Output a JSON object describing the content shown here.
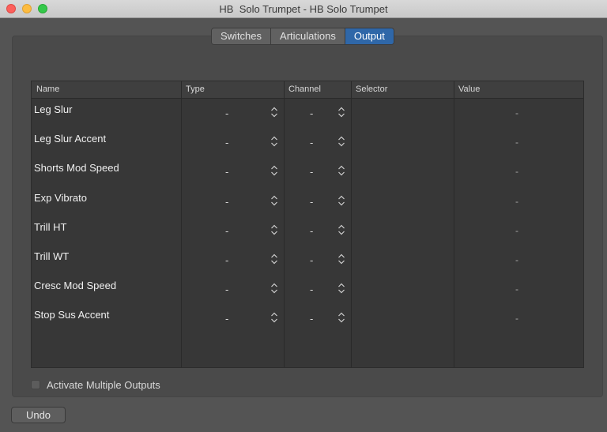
{
  "window": {
    "title": "HB  Solo Trumpet - HB Solo Trumpet"
  },
  "tabs": [
    {
      "label": "Switches",
      "active": false
    },
    {
      "label": "Articulations",
      "active": false
    },
    {
      "label": "Output",
      "active": true
    }
  ],
  "table": {
    "columns": [
      "Name",
      "Type",
      "Channel",
      "Selector",
      "Value"
    ],
    "rows": [
      {
        "name": "Leg Slur",
        "type": "-",
        "channel": "-",
        "selector": "",
        "value": "-"
      },
      {
        "name": "Leg Slur Accent",
        "type": "-",
        "channel": "-",
        "selector": "",
        "value": "-"
      },
      {
        "name": "Shorts Mod Speed",
        "type": "-",
        "channel": "-",
        "selector": "",
        "value": "-"
      },
      {
        "name": "Exp Vibrato",
        "type": "-",
        "channel": "-",
        "selector": "",
        "value": "-"
      },
      {
        "name": "Trill HT",
        "type": "-",
        "channel": "-",
        "selector": "",
        "value": "-"
      },
      {
        "name": "Trill WT",
        "type": "-",
        "channel": "-",
        "selector": "",
        "value": "-"
      },
      {
        "name": "Cresc Mod Speed",
        "type": "-",
        "channel": "-",
        "selector": "",
        "value": "-"
      },
      {
        "name": "Stop Sus Accent",
        "type": "-",
        "channel": "-",
        "selector": "",
        "value": "-"
      }
    ]
  },
  "options": {
    "activate_multiple_outputs_label": "Activate Multiple Outputs",
    "activate_multiple_outputs_checked": false
  },
  "footer": {
    "undo_label": "Undo"
  },
  "colors": {
    "active_tab": "#2f67a8",
    "close": "#fc605c",
    "minimize": "#fdbc40",
    "maximize": "#34c84a"
  }
}
